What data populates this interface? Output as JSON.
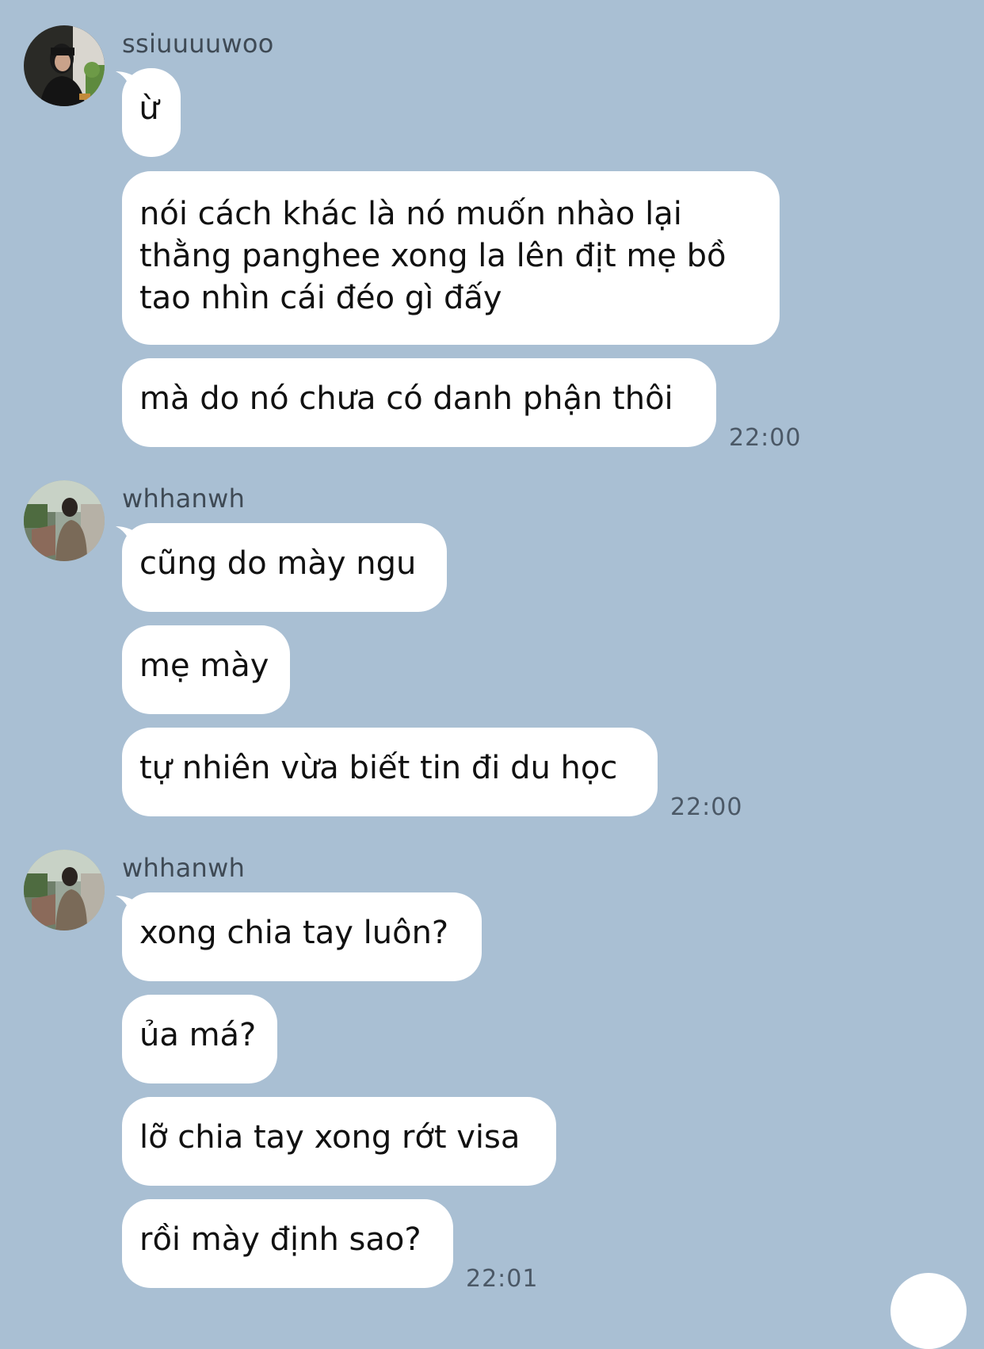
{
  "conversation": [
    {
      "sender": "ssiuuuuwoo",
      "time": "22:00",
      "messages": [
        "ừ",
        "nói cách khác là nó muốn nhào lại thằng panghee xong la lên địt mẹ bồ tao nhìn cái đéo gì đấy",
        "mà do nó chưa có danh phận thôi"
      ]
    },
    {
      "sender": "whhanwh",
      "time": "22:00",
      "messages": [
        "cũng do mày ngu",
        "mẹ mày",
        "tự nhiên vừa biết tin đi du học"
      ]
    },
    {
      "sender": "whhanwh",
      "time": "22:01",
      "messages": [
        "xong chia tay luôn?",
        "ủa má?",
        "lỡ chia tay xong rớt visa",
        "rồi mày định sao?"
      ]
    }
  ],
  "colors": {
    "background": "#a9bfd3",
    "bubble": "#ffffff",
    "text": "#111111",
    "meta": "#4b5866"
  }
}
